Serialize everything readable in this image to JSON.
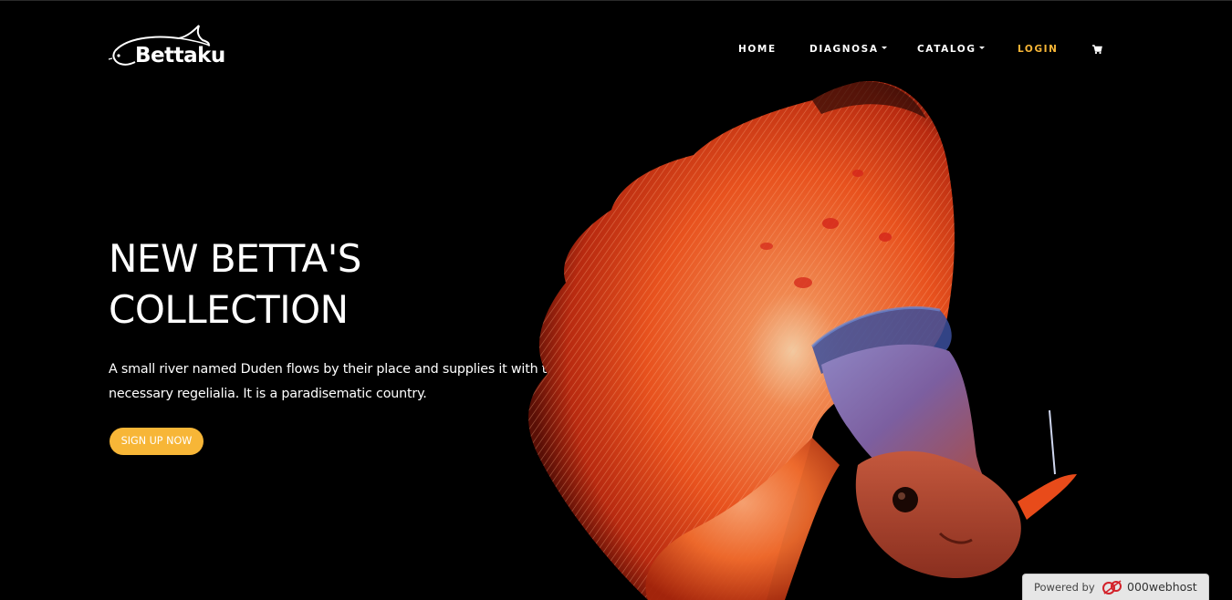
{
  "brand": {
    "logo_text": "Bettaku"
  },
  "nav": {
    "items": [
      {
        "label": "HOME",
        "has_dropdown": false,
        "active": false
      },
      {
        "label": "DIAGNOSA",
        "has_dropdown": true,
        "active": false
      },
      {
        "label": "CATALOG",
        "has_dropdown": true,
        "active": false
      },
      {
        "label": "LOGIN",
        "has_dropdown": false,
        "active": true
      }
    ],
    "cart_icon": "cart-icon"
  },
  "hero": {
    "title_line1": "NEW BETTA'S",
    "title_line2": "COLLECTION",
    "text": "A small river named Duden flows by their place and supplies it with the necessary regelialia. It is a paradisematic country.",
    "cta_label": "SIGN UP NOW",
    "image": "betta-fish"
  },
  "badge": {
    "powered_by": "Powered by",
    "brand": "000webhost"
  },
  "colors": {
    "background": "#000000",
    "accent": "#f7b637",
    "text": "#ffffff"
  }
}
